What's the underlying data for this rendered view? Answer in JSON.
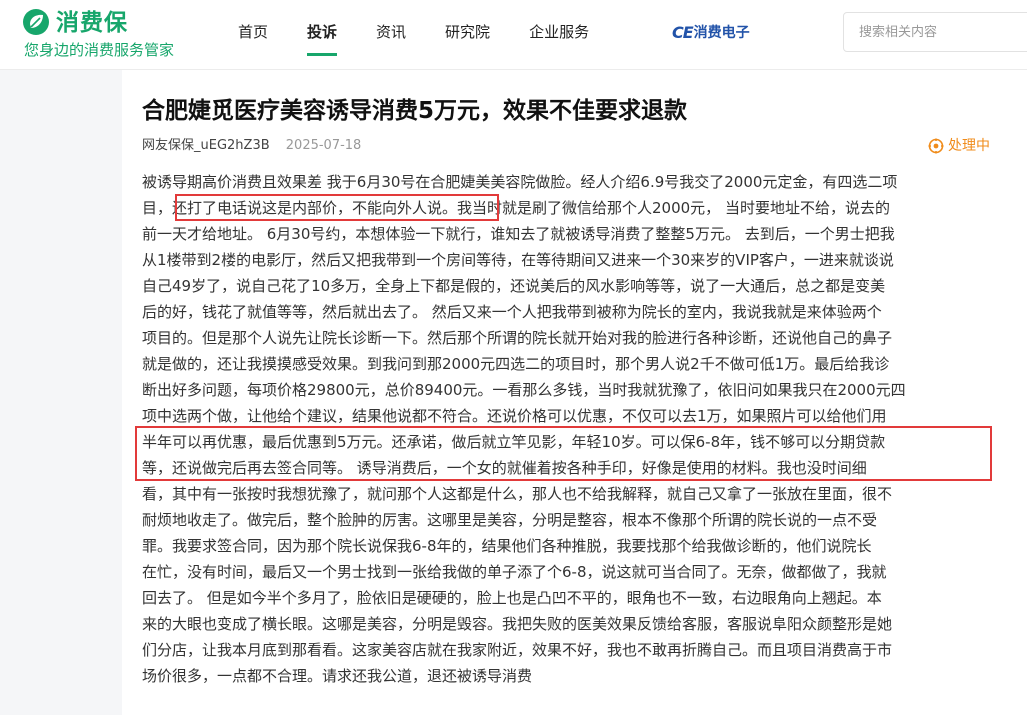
{
  "brand": {
    "name": "消费保",
    "slogan": "您身边的消费服务管家",
    "accent_color": "#17a66b"
  },
  "nav": {
    "items": [
      {
        "label": "首页",
        "active": false
      },
      {
        "label": "投诉",
        "active": true
      },
      {
        "label": "资讯",
        "active": false
      },
      {
        "label": "研究院",
        "active": false
      },
      {
        "label": "企业服务",
        "active": false
      }
    ],
    "brand_link": {
      "prefix": "CE",
      "label": "消费电子",
      "color": "#2253a9"
    }
  },
  "search": {
    "placeholder": "搜索相关内容",
    "value": ""
  },
  "article": {
    "title": "合肥婕觅医疗美容诱导消费5万元，效果不佳要求退款",
    "author": "网友保保_uEG2hZ3B",
    "date": "2025-07-18",
    "status": {
      "label": "处理中",
      "icon": "processing-icon",
      "color": "#f08c1b"
    },
    "body_lines": [
      "被诱导期高价消费且效果差 我于6月30号在合肥婕美美容院做脸。经人介绍6.9号我交了2000元定金，有四选二项",
      "目，还打了电话说这是内部价，不能向外人说。我当时就是刷了微信给那个人2000元， 当时要地址不给，说去的",
      "前一天才给地址。 6月30号约，本想体验一下就行，谁知去了就被诱导消费了整整5万元。 去到后，一个男士把我",
      "从1楼带到2楼的电影厅，然后又把我带到一个房间等待，在等待期间又进来一个30来岁的VIP客户，一进来就谈说",
      "自己49岁了，说自己花了10多万，全身上下都是假的，还说美后的风水影响等等，说了一大通后，总之都是变美",
      "后的好，钱花了就值等等，然后就出去了。 然后又来一个人把我带到被称为院长的室内，我说我就是来体验两个",
      "项目的。但是那个人说先让院长诊断一下。然后那个所谓的院长就开始对我的脸进行各种诊断，还说他自己的鼻子",
      "就是做的，还让我摸摸感受效果。到我问到那2000元四选二的项目时，那个男人说2千不做可低1万。最后给我诊",
      "断出好多问题，每项价格29800元，总价89400元。一看那么多钱，当时我就犹豫了，依旧问如果我只在2000元四",
      "项中选两个做，让他给个建议，结果他说都不符合。还说价格可以优惠，不仅可以去1万，如果照片可以给他们用",
      "半年可以再优惠，最后优惠到5万元。还承诺，做后就立竿见影，年轻10岁。可以保6-8年，钱不够可以分期贷款",
      "等，还说做完后再去签合同等。 诱导消费后，一个女的就催着按各种手印，好像是使用的材料。我也没时间细",
      "看，其中有一张按时我想犹豫了，就问那个人这都是什么，那人也不给我解释，就自己又拿了一张放在里面，很不",
      "耐烦地收走了。做完后，整个脸肿的厉害。这哪里是美容，分明是整容，根本不像那个所谓的院长说的一点不受",
      "罪。我要求签合同，因为那个院长说保我6-8年的，结果他们各种推脱，我要找那个给我做诊断的，他们说院长",
      "在忙，没有时间，最后又一个男士找到一张给我做的单子添了个6-8，说这就可当合同了。无奈，做都做了，我就",
      "回去了。 但是如今半个多月了，脸依旧是硬硬的，脸上也是凸凹不平的，眼角也不一致，右边眼角向上翘起。本",
      "来的大眼也变成了横长眼。这哪是美容，分明是毁容。我把失败的医美效果反馈给客服，客服说阜阳众颜整形是她",
      "们分店，让我本月底到那看看。这家美容店就在我家附近，效果不好，我也不敢再折腾自己。而且项目消费高于市",
      "场价很多，一点都不合理。请求还我公道，退还被诱导消费"
    ]
  }
}
